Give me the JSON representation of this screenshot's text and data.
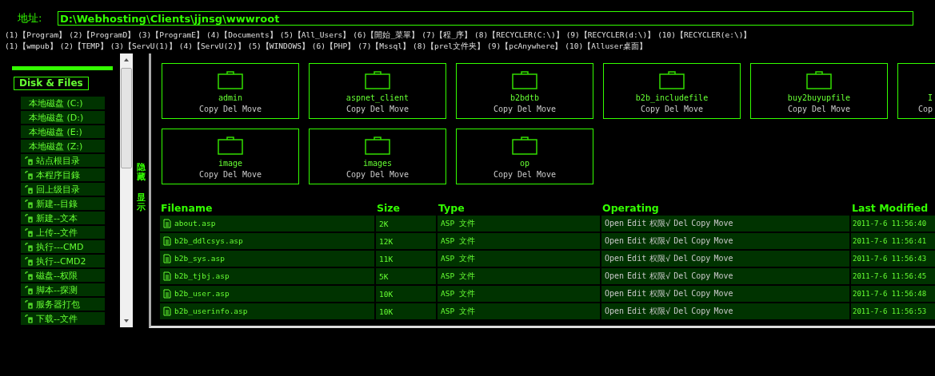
{
  "address": {
    "label": "地址:",
    "value": "D:\\Webhosting\\Clients\\jjnsg\\wwwroot"
  },
  "shortcuts": [
    [
      {
        "num": "(1)",
        "label": "【Program】"
      },
      {
        "num": "(2)",
        "label": "【ProgramD】"
      },
      {
        "num": "(3)",
        "label": "【ProgramE】"
      },
      {
        "num": "(4)",
        "label": "【Documents】"
      },
      {
        "num": "(5)",
        "label": "【All_Users】"
      },
      {
        "num": "(6)",
        "label": "【開始_菜單】"
      },
      {
        "num": "(7)",
        "label": "【程_序】"
      },
      {
        "num": "(8)",
        "label": "【RECYCLER(C:\\)】"
      },
      {
        "num": "(9)",
        "label": "【RECYCLER(d:\\)】"
      },
      {
        "num": "(10)",
        "label": "【RECYCLER(e:\\)】"
      }
    ],
    [
      {
        "num": "(1)",
        "label": "【wmpub】"
      },
      {
        "num": "(2)",
        "label": "【TEMP】"
      },
      {
        "num": "(3)",
        "label": "【ServU(1)】"
      },
      {
        "num": "(4)",
        "label": "【ServU(2)】"
      },
      {
        "num": "(5)",
        "label": "【WINDOWS】"
      },
      {
        "num": "(6)",
        "label": "【PHP】"
      },
      {
        "num": "(7)",
        "label": "【Mssql】"
      },
      {
        "num": "(8)",
        "label": "【prel文件夹】"
      },
      {
        "num": "(9)",
        "label": "【pcAnywhere】"
      },
      {
        "num": "(10)",
        "label": "【Alluser桌面】"
      }
    ]
  ],
  "sidebar": {
    "title": "Disk & Files",
    "items": [
      {
        "kind": "drive",
        "label": "本地磁盘 (C:)"
      },
      {
        "kind": "drive",
        "label": "本地磁盘 (D:)"
      },
      {
        "kind": "drive",
        "label": "本地磁盘 (E:)"
      },
      {
        "kind": "drive",
        "label": "本地磁盘 (Z:)"
      },
      {
        "kind": "command",
        "label": "站点根目录"
      },
      {
        "kind": "command",
        "label": "本程序目錄"
      },
      {
        "kind": "command",
        "label": "回上级目录"
      },
      {
        "kind": "command",
        "label": "新建--目錄"
      },
      {
        "kind": "command",
        "label": "新建--文本"
      },
      {
        "kind": "command",
        "label": "上传--文件"
      },
      {
        "kind": "command",
        "label": "执行---CMD"
      },
      {
        "kind": "command",
        "label": "执行--CMD2"
      },
      {
        "kind": "command",
        "label": "磁盘--权限"
      },
      {
        "kind": "command",
        "label": "脚本--探测"
      },
      {
        "kind": "command",
        "label": "服务器打包"
      },
      {
        "kind": "command",
        "label": "下载--文件"
      }
    ]
  },
  "toggles": [
    "隐藏",
    "显示"
  ],
  "folders": [
    {
      "kind": "full",
      "name": "admin",
      "actions": [
        "Copy",
        "Del",
        "Move"
      ]
    },
    {
      "kind": "full",
      "name": "aspnet_client",
      "actions": [
        "Copy",
        "Del",
        "Move"
      ]
    },
    {
      "kind": "full",
      "name": "b2bdtb",
      "actions": [
        "Copy",
        "Del",
        "Move"
      ]
    },
    {
      "kind": "full",
      "name": "b2b_includefile",
      "actions": [
        "Copy",
        "Del",
        "Move"
      ]
    },
    {
      "kind": "full",
      "name": "buy2buyupfile",
      "actions": [
        "Copy",
        "Del",
        "Move"
      ]
    },
    {
      "kind": "partial",
      "name": "I",
      "actions": [
        "Cop"
      ]
    },
    {
      "kind": "full",
      "name": "image",
      "actions": [
        "Copy",
        "Del",
        "Move"
      ]
    },
    {
      "kind": "full",
      "name": "images",
      "actions": [
        "Copy",
        "Del",
        "Move"
      ]
    },
    {
      "kind": "full",
      "name": "op",
      "actions": [
        "Copy",
        "Del",
        "Move"
      ]
    }
  ],
  "table": {
    "columns": [
      "Filename",
      "Size",
      "Type",
      "Operating",
      "Last Modified"
    ],
    "rows": [
      {
        "name": "about.asp",
        "size": "2K",
        "type": "ASP 文件",
        "ops": [
          "Open",
          "Edit",
          "权限√",
          "Del",
          "Copy",
          "Move"
        ],
        "modified": "2011-7-6 11:56:40"
      },
      {
        "name": "b2b_ddlcsys.asp",
        "size": "12K",
        "type": "ASP 文件",
        "ops": [
          "Open",
          "Edit",
          "权限√",
          "Del",
          "Copy",
          "Move"
        ],
        "modified": "2011-7-6 11:56:41"
      },
      {
        "name": "b2b_sys.asp",
        "size": "11K",
        "type": "ASP 文件",
        "ops": [
          "Open",
          "Edit",
          "权限√",
          "Del",
          "Copy",
          "Move"
        ],
        "modified": "2011-7-6 11:56:43"
      },
      {
        "name": "b2b_tjbj.asp",
        "size": "5K",
        "type": "ASP 文件",
        "ops": [
          "Open",
          "Edit",
          "权限√",
          "Del",
          "Copy",
          "Move"
        ],
        "modified": "2011-7-6 11:56:45"
      },
      {
        "name": "b2b_user.asp",
        "size": "10K",
        "type": "ASP 文件",
        "ops": [
          "Open",
          "Edit",
          "权限√",
          "Del",
          "Copy",
          "Move"
        ],
        "modified": "2011-7-6 11:56:48"
      },
      {
        "name": "b2b_userinfo.asp",
        "size": "10K",
        "type": "ASP 文件",
        "ops": [
          "Open",
          "Edit",
          "权限√",
          "Del",
          "Copy",
          "Move"
        ],
        "modified": "2011-7-6 11:56:53"
      }
    ]
  }
}
